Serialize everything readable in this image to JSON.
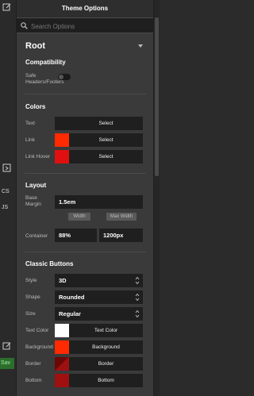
{
  "left_strip": {
    "label_cs": "CS",
    "label_js": "JS",
    "label_save": "Sav"
  },
  "header": {
    "title": "Theme Options"
  },
  "search": {
    "placeholder": "Search Options"
  },
  "root": {
    "title": "Root"
  },
  "compatibility": {
    "title": "Compatibility",
    "safe_headers_label": "Safe Headers/Footers",
    "safe_headers_enabled": false
  },
  "colors": {
    "title": "Colors",
    "rows": [
      {
        "label": "Text",
        "button": "Select",
        "swatch": "#1f1f1f"
      },
      {
        "label": "Link",
        "button": "Select",
        "swatch": "#ff2a00"
      },
      {
        "label": "Link Hover",
        "button": "Select",
        "swatch": "#e01010"
      }
    ]
  },
  "layout": {
    "title": "Layout",
    "base_margin_label": "Base Margin",
    "base_margin_value": "1.5em",
    "container_label": "Container",
    "width_tag": "Width",
    "max_width_tag": "Max Width",
    "width_value": "88%",
    "max_width_value": "1200px"
  },
  "classic_buttons": {
    "title": "Classic Buttons",
    "style_label": "Style",
    "style_value": "3D",
    "shape_label": "Shape",
    "shape_value": "Rounded",
    "size_label": "Size",
    "size_value": "Regular",
    "color_rows": [
      {
        "label": "Text Color",
        "button": "Text Color",
        "swatch": "#ffffff"
      },
      {
        "label": "Background",
        "button": "Background",
        "swatch": "#ff2a00"
      },
      {
        "label": "Border",
        "button": "Border",
        "swatch": "#a01010"
      },
      {
        "label": "Bottom",
        "button": "Bottom",
        "swatch": "#a01010"
      }
    ]
  },
  "colors_meta": {
    "accent_red": "#ff2a00",
    "panel_bg": "#3a3a3a",
    "field_bg": "#1f1f1f"
  }
}
